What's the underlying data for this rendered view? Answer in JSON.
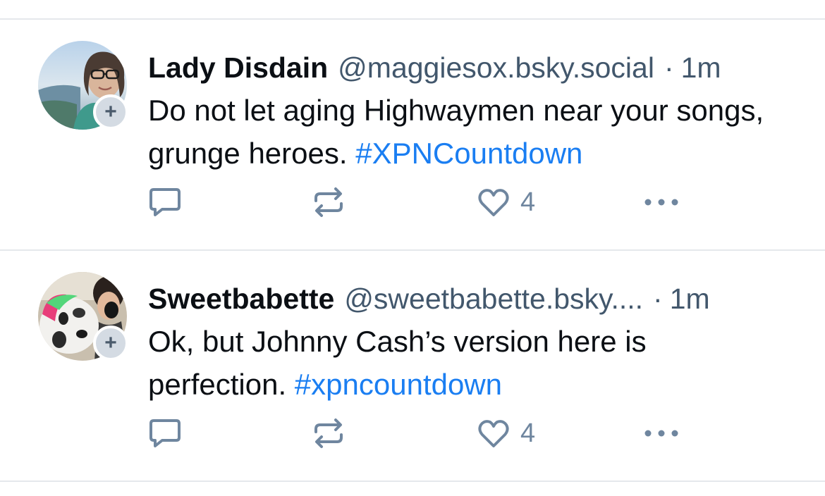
{
  "posts": [
    {
      "author_name": "Lady Disdain",
      "handle": "@maggiesox.bsky.social",
      "separator": "·",
      "time": "1m",
      "text": "Do not let aging Highwaymen near your songs, grunge heroes. ",
      "hashtag": "#XPNCountdown",
      "like_count": "4",
      "follow_badge": "+"
    },
    {
      "author_name": "Sweetbabette",
      "handle": "@sweetbabette.bsky....",
      "separator": "·",
      "time": "1m",
      "text": "Ok, but Johnny Cash’s version here is perfection. ",
      "hashtag": "#xpncountdown",
      "like_count": "4",
      "follow_badge": "+"
    }
  ],
  "colors": {
    "name": "#0b0f14",
    "muted": "#42576c",
    "hashtag": "#1a7ef2",
    "icon": "#6f869f",
    "divider": "#e5e8ec"
  },
  "icons": [
    "reply-icon",
    "repost-icon",
    "heart-icon",
    "more-icon",
    "follow-plus-icon"
  ]
}
